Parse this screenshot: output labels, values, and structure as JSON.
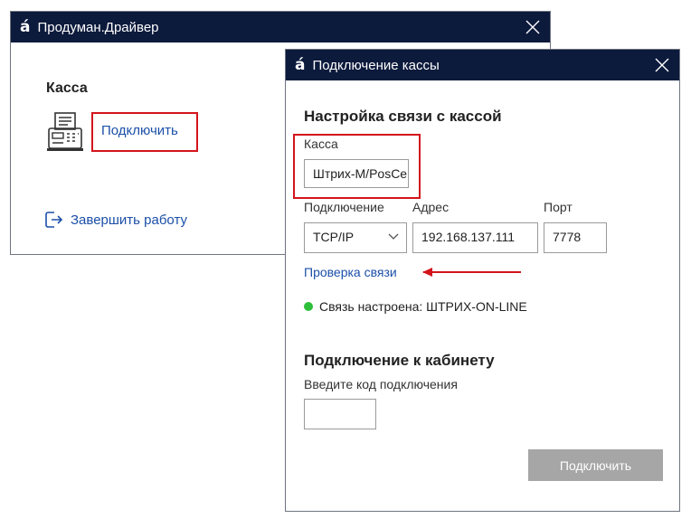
{
  "main_window": {
    "logo": "á",
    "title": "Продуман.Драйвер",
    "section_title": "Касса",
    "connect_link": "Подключить",
    "logout_label": "Завершить работу"
  },
  "dialog": {
    "logo": "á",
    "title": "Подключение кассы",
    "heading": "Настройка связи с кассой",
    "kassa_label": "Касса",
    "kassa_value": "Штрих-М/PosCenter",
    "connection_label": "Подключение",
    "connection_value": "TCP/IP",
    "address_label": "Адрес",
    "address_value": "192.168.137.111",
    "port_label": "Порт",
    "port_value": "7778",
    "check_link": "Проверка связи",
    "status_text": "Связь настроена: ШТРИХ-ON-LINE",
    "cabinet_heading": "Подключение к кабинету",
    "code_label": "Введите код подключения",
    "code_value": "",
    "submit_label": "Подключить"
  },
  "colors": {
    "titlebar": "#0c1a3c",
    "link": "#1b4fa8",
    "highlight": "#d3141c",
    "status_ok": "#2fbf3a",
    "button_disabled": "#a6a6a6"
  }
}
